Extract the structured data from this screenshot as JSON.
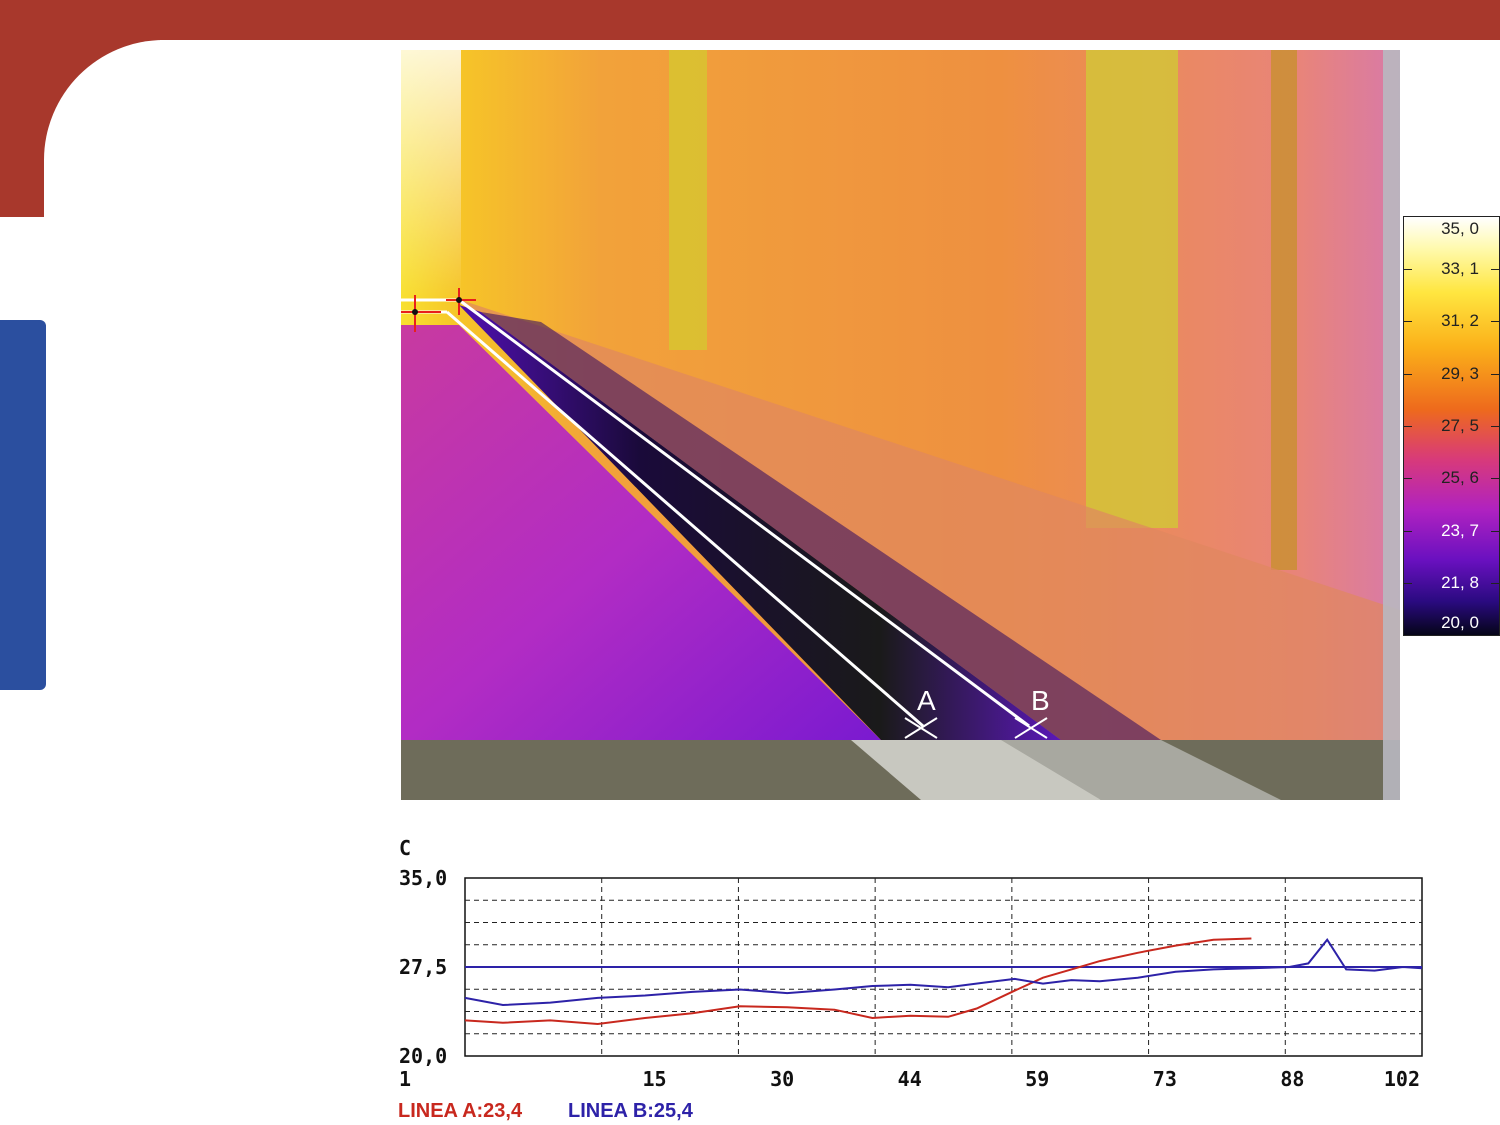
{
  "thermal_image": {
    "line_a_label": "A",
    "line_b_label": "B",
    "colors": {
      "line": "#ffffff",
      "marker": "#e8201c"
    }
  },
  "color_scale": {
    "labels": [
      "35, 0",
      "33, 1",
      "31, 2",
      "29, 3",
      "27, 5",
      "25, 6",
      "23, 7",
      "21, 8",
      "20, 0"
    ]
  },
  "chart_data": {
    "type": "line",
    "title": "",
    "ylabel": "C",
    "ylim": [
      20.0,
      35.0
    ],
    "xlim": [
      1,
      102
    ],
    "y_ticks": [
      "35,0",
      "27,5",
      "20,0"
    ],
    "x_ticks": [
      "1",
      "15",
      "30",
      "44",
      "59",
      "73",
      "88",
      "102"
    ],
    "grid": true,
    "reference_line": {
      "y": 27.5,
      "color": "#2d22a8"
    },
    "series": [
      {
        "name": "LINEA A:23,4",
        "color": "#c8281e",
        "x": [
          1,
          5,
          10,
          15,
          20,
          25,
          30,
          35,
          40,
          44,
          48,
          52,
          55,
          59,
          62,
          65,
          68,
          72,
          76,
          80,
          84
        ],
        "y": [
          23.0,
          22.8,
          23.0,
          22.7,
          23.2,
          23.6,
          24.2,
          24.1,
          23.9,
          23.2,
          23.4,
          23.3,
          24.0,
          25.5,
          26.6,
          27.3,
          28.0,
          28.7,
          29.3,
          29.8,
          29.9
        ]
      },
      {
        "name": "LINEA B:25,4",
        "color": "#2d22a8",
        "x": [
          1,
          5,
          10,
          15,
          20,
          25,
          30,
          35,
          40,
          44,
          48,
          52,
          56,
          59,
          62,
          65,
          68,
          72,
          76,
          80,
          84,
          88,
          90,
          92,
          94,
          97,
          100,
          102
        ],
        "y": [
          24.9,
          24.3,
          24.5,
          24.9,
          25.1,
          25.4,
          25.6,
          25.3,
          25.6,
          25.9,
          26.0,
          25.8,
          26.2,
          26.5,
          26.1,
          26.4,
          26.3,
          26.6,
          27.1,
          27.3,
          27.4,
          27.5,
          27.8,
          29.8,
          27.3,
          27.2,
          27.5,
          27.4
        ]
      }
    ]
  }
}
